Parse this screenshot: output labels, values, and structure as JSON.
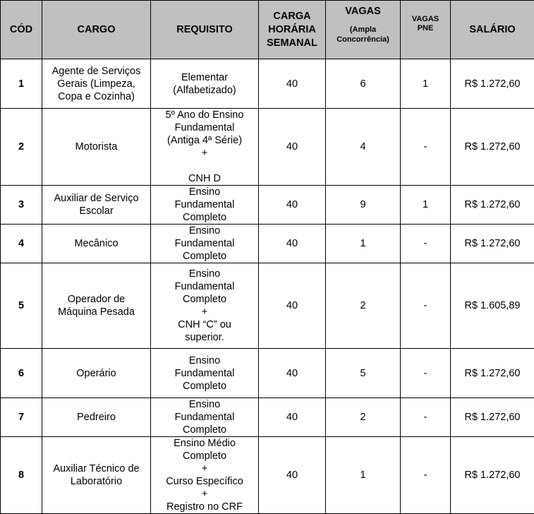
{
  "table": {
    "headers": {
      "cod": "CÓD",
      "cargo": "CARGO",
      "requisito": "REQUISITO",
      "carga_horaria": [
        "CARGA",
        "HORÁRIA",
        "SEMANAL"
      ],
      "vagas_main": "VAGAS",
      "vagas_sub": [
        "(Ampla",
        "Concorrência)"
      ],
      "vagas_pne": [
        "VAGAS",
        "PNE"
      ],
      "salario": "SALÁRIO"
    },
    "rows": [
      {
        "cod": "1",
        "cargo": [
          "Agente de Serviços",
          "Gerais (Limpeza,",
          "Copa e Cozinha)"
        ],
        "requisito": [
          "Elementar",
          "(Alfabetizado)"
        ],
        "carga": "40",
        "vagas": "6",
        "pne": "1",
        "salario": "R$ 1.272,60"
      },
      {
        "cod": "2",
        "cargo": [
          "Motorista"
        ],
        "requisito": [
          "5º Ano do Ensino",
          "Fundamental",
          "(Antiga 4ª Série)",
          "+",
          "",
          "CNH D"
        ],
        "carga": "40",
        "vagas": "4",
        "pne": "-",
        "salario": "R$ 1.272,60"
      },
      {
        "cod": "3",
        "cargo": [
          "Auxiliar de Serviço",
          "Escolar"
        ],
        "requisito": [
          "Ensino",
          "Fundamental",
          "Completo"
        ],
        "carga": "40",
        "vagas": "9",
        "pne": "1",
        "salario": "R$ 1.272,60"
      },
      {
        "cod": "4",
        "cargo": [
          "Mecânico"
        ],
        "requisito": [
          "Ensino",
          "Fundamental",
          "Completo"
        ],
        "carga": "40",
        "vagas": "1",
        "pne": "-",
        "salario": "R$ 1.272,60"
      },
      {
        "cod": "5",
        "cargo": [
          "Operador de",
          "Máquina Pesada"
        ],
        "requisito": [
          "Ensino",
          "Fundamental",
          "Completo",
          "+",
          "CNH “C” ou",
          "superior."
        ],
        "carga": "40",
        "vagas": "2",
        "pne": "-",
        "salario": "R$ 1.605,89"
      },
      {
        "cod": "6",
        "cargo": [
          "Operário"
        ],
        "requisito": [
          "Ensino",
          "Fundamental",
          "Completo"
        ],
        "carga": "40",
        "vagas": "5",
        "pne": "-",
        "salario": "R$ 1.272,60"
      },
      {
        "cod": "7",
        "cargo": [
          "Pedreiro"
        ],
        "requisito": [
          "Ensino",
          "Fundamental",
          "Completo"
        ],
        "carga": "40",
        "vagas": "2",
        "pne": "-",
        "salario": "R$ 1.272,60"
      },
      {
        "cod": "8",
        "cargo": [
          "Auxiliar Técnico de",
          "Laboratório"
        ],
        "requisito": [
          "Ensino Médio",
          "Completo",
          "+",
          "Curso Específico",
          "+",
          "Registro no CRF"
        ],
        "carga": "40",
        "vagas": "1",
        "pne": "-",
        "salario": "R$ 1.272,60"
      }
    ]
  }
}
